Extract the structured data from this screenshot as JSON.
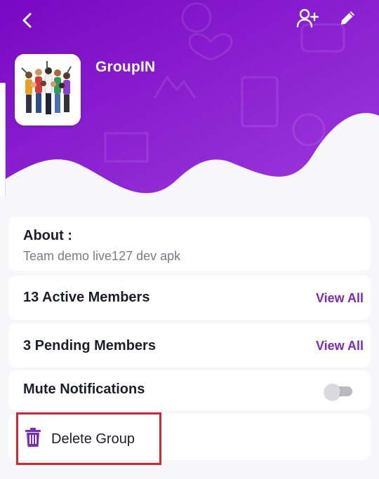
{
  "header": {
    "group_name": "GroupIN",
    "colors": {
      "gradient_start": "#7b0fc4",
      "gradient_end": "#9b35dc"
    }
  },
  "about": {
    "title": "About :",
    "description": "Team demo live127 dev apk"
  },
  "members": {
    "active_label": "13 Active Members",
    "active_link": "View All",
    "pending_label": "3 Pending Members",
    "pending_link": "View All"
  },
  "mute": {
    "label": "Mute Notifications",
    "enabled": false
  },
  "delete": {
    "label": "Delete Group"
  },
  "icons": [
    "back-icon",
    "add-member-icon",
    "edit-icon",
    "trash-icon"
  ],
  "accent_color": "#7a2bb8",
  "highlight_color": "#d8262f"
}
